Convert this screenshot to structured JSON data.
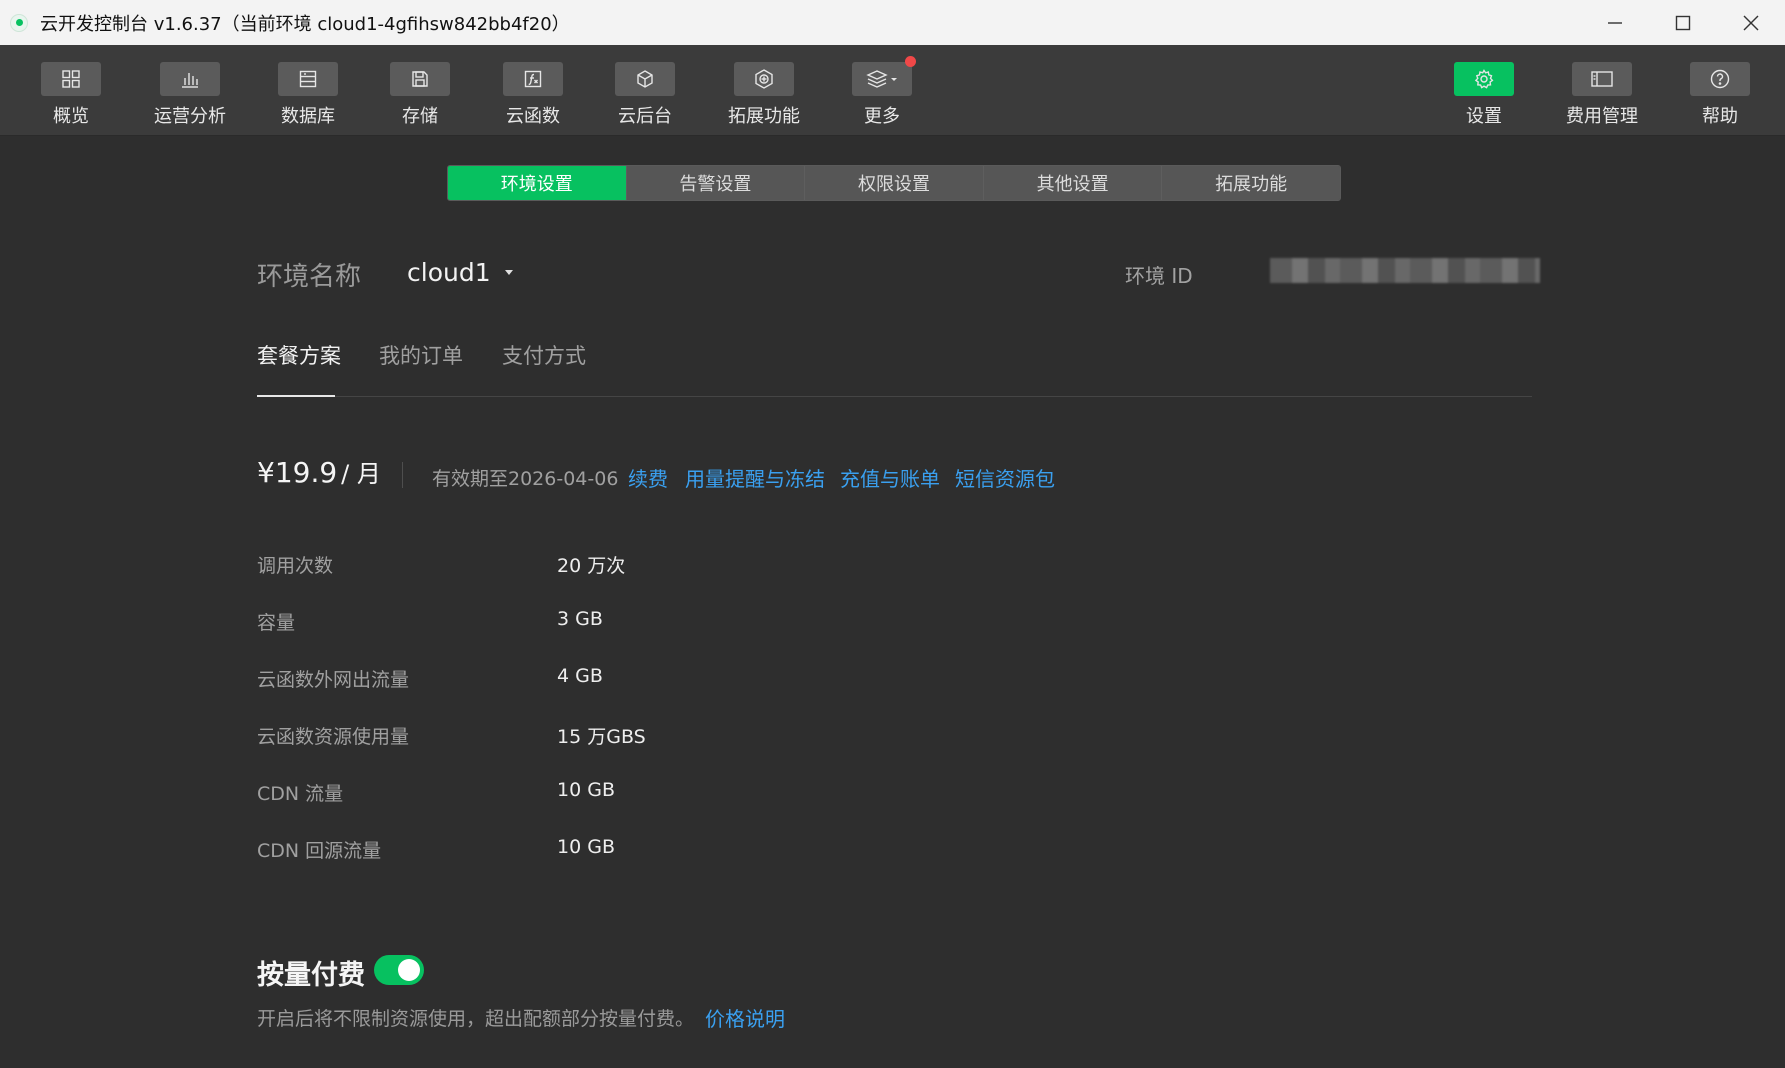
{
  "window": {
    "title": "云开发控制台 v1.6.37（当前环境 cloud1-4gfihsw842bb4f20）"
  },
  "toolbar": {
    "left": [
      {
        "label": "概览",
        "icon": "grid-icon"
      },
      {
        "label": "运营分析",
        "icon": "bar-chart-icon"
      },
      {
        "label": "数据库",
        "icon": "database-icon"
      },
      {
        "label": "存储",
        "icon": "save-icon"
      },
      {
        "label": "云函数",
        "icon": "function-icon"
      },
      {
        "label": "云后台",
        "icon": "cube-icon"
      },
      {
        "label": "拓展功能",
        "icon": "extension-icon"
      },
      {
        "label": "更多",
        "icon": "layers-icon"
      }
    ],
    "right": [
      {
        "label": "设置",
        "icon": "gear-icon",
        "active": true
      },
      {
        "label": "费用管理",
        "icon": "billing-icon"
      },
      {
        "label": "帮助",
        "icon": "help-icon"
      }
    ]
  },
  "settings_tabs": [
    "环境设置",
    "告警设置",
    "权限设置",
    "其他设置",
    "拓展功能"
  ],
  "settings_tabs_active": 0,
  "env": {
    "name_label": "环境名称",
    "name_value": "cloud1",
    "id_label": "环境 ID"
  },
  "subtabs": [
    "套餐方案",
    "我的订单",
    "支付方式"
  ],
  "subtabs_active": 0,
  "plan": {
    "price": "¥19.9",
    "price_unit": "/ 月",
    "expire_text": "有效期至2026-04-06",
    "links": [
      "续费",
      "用量提醒与冻结",
      "充值与账单",
      "短信资源包"
    ],
    "quotas": [
      {
        "label": "调用次数",
        "value": "20 万次"
      },
      {
        "label": "容量",
        "value": "3 GB"
      },
      {
        "label": "云函数外网出流量",
        "value": "4 GB"
      },
      {
        "label": "云函数资源使用量",
        "value": "15 万GBS"
      },
      {
        "label": "CDN 流量",
        "value": "10 GB"
      },
      {
        "label": "CDN 回源流量",
        "value": "10 GB"
      }
    ]
  },
  "pay_as_you_go": {
    "title": "按量付费",
    "enabled": true,
    "description": "开启后将不限制资源使用，超出配额部分按量付费。",
    "link": "价格说明"
  },
  "colors": {
    "accent": "#07c160",
    "link": "#3aa0f0",
    "background": "#2e2e2e"
  }
}
